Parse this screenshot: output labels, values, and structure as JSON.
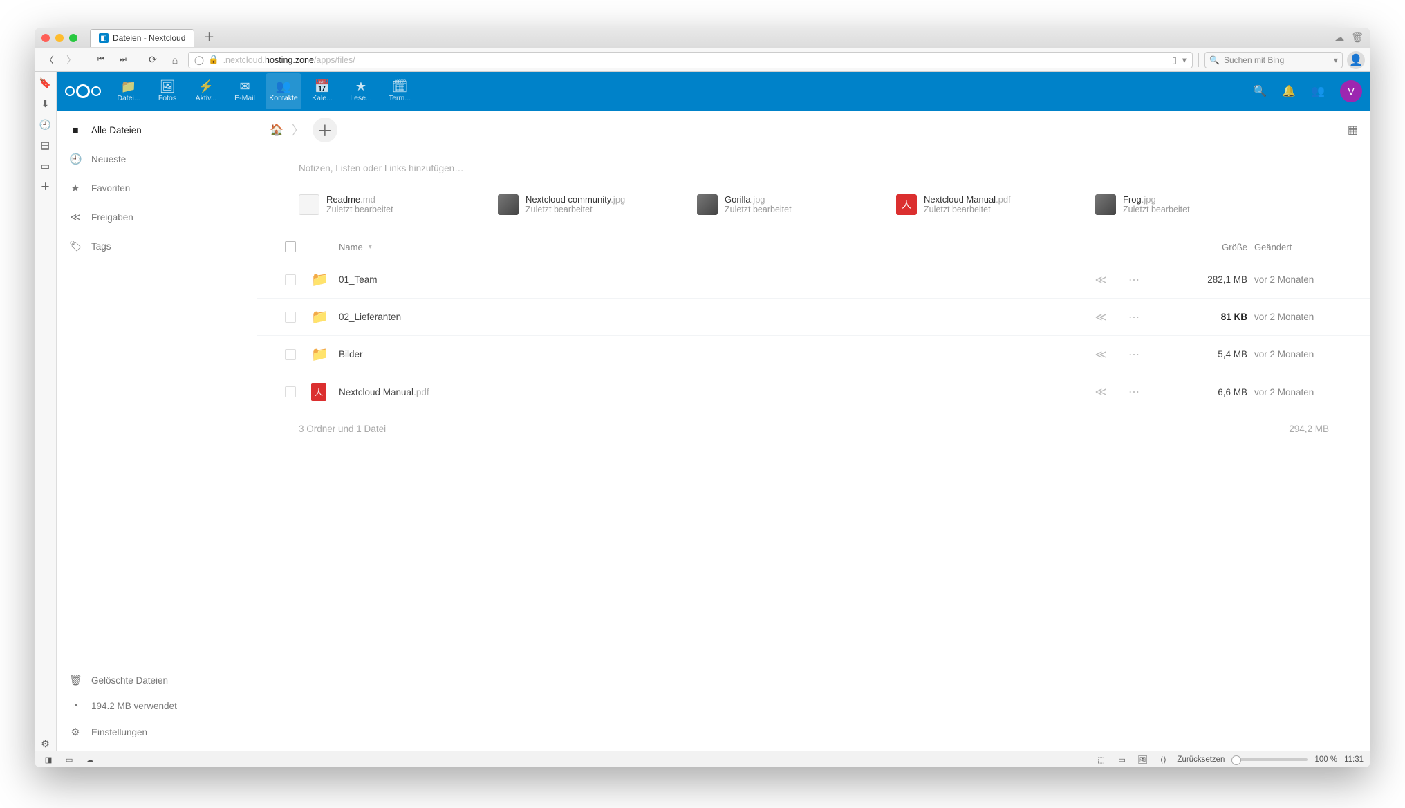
{
  "browser": {
    "tab_title": "Dateien - Nextcloud",
    "url_prefix": ".nextcloud.",
    "url_host": "hosting.zone",
    "url_path": "/apps/files/",
    "search_placeholder": "Suchen mit Bing"
  },
  "header": {
    "apps": [
      {
        "label": "Datei...",
        "icon": "folder"
      },
      {
        "label": "Fotos",
        "icon": "image"
      },
      {
        "label": "Aktiv...",
        "icon": "bolt"
      },
      {
        "label": "E-Mail",
        "icon": "mail"
      },
      {
        "label": "Kontakte",
        "icon": "users",
        "active": true
      },
      {
        "label": "Kale...",
        "icon": "calendar"
      },
      {
        "label": "Lese...",
        "icon": "star"
      },
      {
        "label": "Term...",
        "icon": "date"
      }
    ],
    "user_initial": "V"
  },
  "sidebar": {
    "items": [
      {
        "icon": "folder",
        "label": "Alle Dateien",
        "active": true
      },
      {
        "icon": "clock",
        "label": "Neueste"
      },
      {
        "icon": "star",
        "label": "Favoriten"
      },
      {
        "icon": "share",
        "label": "Freigaben"
      },
      {
        "icon": "tag",
        "label": "Tags"
      }
    ],
    "bottom": [
      {
        "icon": "trash",
        "label": "Gelöschte Dateien"
      },
      {
        "icon": "pie",
        "label": "194.2 MB verwendet"
      },
      {
        "icon": "gear",
        "label": "Einstellungen"
      }
    ]
  },
  "note_placeholder": "Notizen, Listen oder Links hinzufügen…",
  "recent": [
    {
      "name": "Readme",
      "ext": ".md",
      "sub": "Zuletzt bearbeitet",
      "thumb": "txt"
    },
    {
      "name": "Nextcloud community",
      "ext": ".jpg",
      "sub": "Zuletzt bearbeitet",
      "thumb": "img"
    },
    {
      "name": "Gorilla",
      "ext": ".jpg",
      "sub": "Zuletzt bearbeitet",
      "thumb": "img"
    },
    {
      "name": "Nextcloud Manual",
      "ext": ".pdf",
      "sub": "Zuletzt bearbeitet",
      "thumb": "pdf"
    },
    {
      "name": "Frog",
      "ext": ".jpg",
      "sub": "Zuletzt bearbeitet",
      "thumb": "img"
    }
  ],
  "columns": {
    "name": "Name",
    "size": "Größe",
    "modified": "Geändert"
  },
  "files": [
    {
      "type": "folder",
      "name": "01_Team",
      "ext": "",
      "size": "282,1 MB",
      "modified": "vor 2 Monaten"
    },
    {
      "type": "folder",
      "name": "02_Lieferanten",
      "ext": "",
      "size": "81 KB",
      "modified": "vor 2 Monaten"
    },
    {
      "type": "folder",
      "name": "Bilder",
      "ext": "",
      "size": "5,4 MB",
      "modified": "vor 2 Monaten"
    },
    {
      "type": "pdf",
      "name": "Nextcloud Manual",
      "ext": ".pdf",
      "size": "6,6 MB",
      "modified": "vor 2 Monaten"
    }
  ],
  "summary": {
    "text": "3 Ordner und 1 Datei",
    "total": "294,2 MB"
  },
  "statusbar": {
    "reset": "Zurücksetzen",
    "zoom": "100 %",
    "time": "11:31"
  }
}
